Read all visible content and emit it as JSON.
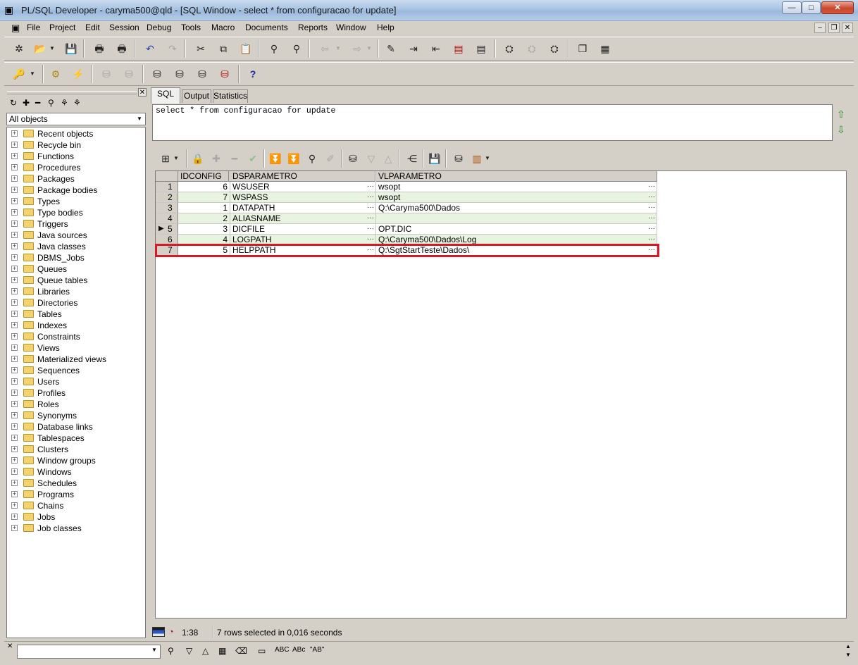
{
  "window": {
    "title": "PL/SQL Developer - caryma500@qld - [SQL Window - select * from configuracao for update]",
    "min": "—",
    "max": "□",
    "close": "✕"
  },
  "menu": {
    "items": [
      "File",
      "Project",
      "Edit",
      "Session",
      "Debug",
      "Tools",
      "Macro",
      "Documents",
      "Reports",
      "Window",
      "Help"
    ],
    "mdi_min": "–",
    "mdi_restore": "❐",
    "mdi_close": "✕"
  },
  "toolbar1": {
    "icons": [
      "new-icon",
      "open-icon",
      "dropdown-icon",
      "save-icon",
      "print-icon",
      "print-preview-icon",
      "undo-icon",
      "redo-icon",
      "cut-icon",
      "copy-icon",
      "paste-icon",
      "find-icon",
      "find-replace-icon",
      "back-icon",
      "back-dropdown-icon",
      "forward-icon",
      "forward-dropdown-icon",
      "beautify-icon",
      "indent-icon",
      "unindent-icon",
      "comment-icon",
      "uncomment-icon",
      "describe-icon",
      "compile-icon",
      "explain-icon",
      "cascade-icon",
      "tile-icon"
    ]
  },
  "toolbar2": {
    "icons": [
      "key-icon",
      "key-dropdown-icon",
      "execute-icon",
      "break-icon",
      "commit-icon",
      "rollback-icon",
      "sql-window-icon",
      "command-window-icon",
      "test-window-icon",
      "report-window-icon",
      "help-icon"
    ],
    "help_label": "?"
  },
  "browser": {
    "close": "✕",
    "tool_icons": [
      "refresh-icon",
      "add-icon",
      "remove-icon",
      "find-icon",
      "filter-icon",
      "filter-edit-icon"
    ],
    "filter_value": "All objects",
    "items": [
      "Recent objects",
      "Recycle bin",
      "Functions",
      "Procedures",
      "Packages",
      "Package bodies",
      "Types",
      "Type bodies",
      "Triggers",
      "Java sources",
      "Java classes",
      "DBMS_Jobs",
      "Queues",
      "Queue tables",
      "Libraries",
      "Directories",
      "Tables",
      "Indexes",
      "Constraints",
      "Views",
      "Materialized views",
      "Sequences",
      "Users",
      "Profiles",
      "Roles",
      "Synonyms",
      "Database links",
      "Tablespaces",
      "Clusters",
      "Window groups",
      "Windows",
      "Schedules",
      "Programs",
      "Chains",
      "Jobs",
      "Job classes"
    ]
  },
  "tabs": [
    "SQL",
    "Output",
    "Statistics"
  ],
  "sql": {
    "text": "select * from configuracao for update"
  },
  "grid": {
    "columns": [
      "IDCONFIG",
      "DSPARAMETRO",
      "VLPARAMETRO"
    ],
    "rows": [
      {
        "num": "1",
        "idconfig": "6",
        "dsparametro": "WSUSER",
        "vlparametro": "wsopt"
      },
      {
        "num": "2",
        "idconfig": "7",
        "dsparametro": "WSPASS",
        "vlparametro": "wsopt"
      },
      {
        "num": "3",
        "idconfig": "1",
        "dsparametro": "DATAPATH",
        "vlparametro": "Q:\\Caryma500\\Dados"
      },
      {
        "num": "4",
        "idconfig": "2",
        "dsparametro": "ALIASNAME",
        "vlparametro": ""
      },
      {
        "num": "5",
        "idconfig": "3",
        "dsparametro": "DICFILE",
        "vlparametro": "OPT.DIC"
      },
      {
        "num": "6",
        "idconfig": "4",
        "dsparametro": "LOGPATH",
        "vlparametro": "Q:\\Caryma500\\Dados\\Log"
      },
      {
        "num": "7",
        "idconfig": "5",
        "dsparametro": "HELPPATH",
        "vlparametro": "Q:\\SgtStartTeste\\Dados\\"
      }
    ],
    "current_row": "5",
    "ellipsis": "···",
    "row_marker": "▶"
  },
  "statusbar": {
    "position": "1:38",
    "message": "7 rows selected in 0,016 seconds"
  },
  "findbar": {
    "abc1": "ABC",
    "abc2": "ABc",
    "abc3": "\"AB\""
  },
  "colors": {
    "highlight_box": "#d7192a",
    "alt_row": "#e8f4e0"
  }
}
